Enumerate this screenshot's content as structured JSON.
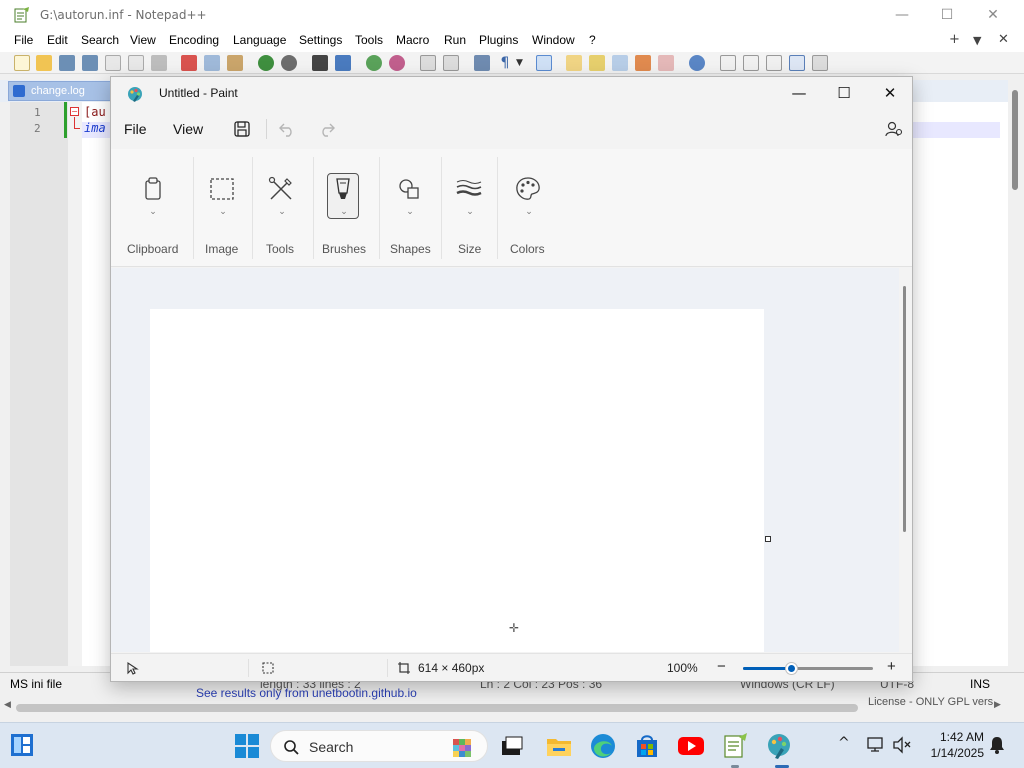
{
  "notepadpp": {
    "title": "G:\\autorun.inf - Notepad++",
    "menu": [
      "File",
      "Edit",
      "Search",
      "View",
      "Encoding",
      "Language",
      "Settings",
      "Tools",
      "Macro",
      "Run",
      "Plugins",
      "Window",
      "?"
    ],
    "menu_right": {
      "add": "+",
      "dropdown": "▼",
      "close": "✕"
    },
    "tab": {
      "label": "change.log"
    },
    "lines": [
      {
        "num": "1",
        "text": "[au"
      },
      {
        "num": "2",
        "text": "ima"
      }
    ],
    "status": {
      "file_type": "MS ini file",
      "length": "length : 33   lines : 2",
      "position": "Ln : 2    Col : 23    Pos : 36",
      "eol": "Windows (CR LF)",
      "encoding": "UTF-8",
      "mode": "INS"
    },
    "find_results": "See results only from unetbootin.github.io",
    "license": "License - ONLY GPL vers"
  },
  "paint": {
    "title": "Untitled - Paint",
    "menu": {
      "file": "File",
      "view": "View"
    },
    "ribbon": [
      {
        "label": "Clipboard",
        "icon": "clipboard-icon"
      },
      {
        "label": "Image",
        "icon": "selection-icon"
      },
      {
        "label": "Tools",
        "icon": "tools-icon"
      },
      {
        "label": "Brushes",
        "icon": "brush-icon"
      },
      {
        "label": "Shapes",
        "icon": "shapes-icon"
      },
      {
        "label": "Size",
        "icon": "size-icon"
      },
      {
        "label": "Colors",
        "icon": "palette-icon"
      }
    ],
    "status": {
      "canvas_size": "614 × 460px",
      "zoom": "100%",
      "zoom_minus": "−",
      "zoom_plus": "+",
      "zoom_level": 0.38
    },
    "accent": "#005fb8"
  },
  "taskbar": {
    "search_label": "Search",
    "time": "1:42 AM",
    "date": "1/14/2025",
    "tray_chevron": "^"
  }
}
